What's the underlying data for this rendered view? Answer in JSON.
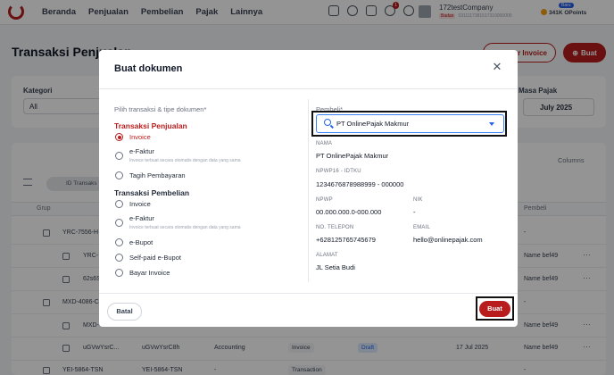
{
  "nav": {
    "items": [
      "Beranda",
      "Penjualan",
      "Pembelian",
      "Pajak",
      "Lainnya"
    ],
    "notification_count": "1",
    "company_name": "172testCompany",
    "company_tag": "Badan",
    "company_id": "0311117381517310000000",
    "points": "341K OPoints",
    "points_badge": "Baru"
  },
  "page": {
    "title": "Transaksi Penjualan",
    "btn_outline_label": "r Invoice",
    "btn_buat_label": "Buat",
    "filter_kategori_label": "Kategori",
    "filter_kategori_value": "All",
    "filter_masa_label": "Masa Pajak",
    "filter_masa_value": "July 2025",
    "columns_label": "Columns",
    "id_pill": "ID Transaks",
    "th_grup": "Grup",
    "th_pembeli": "Pembeli"
  },
  "rows": [
    {
      "id": "YRC-7556-H",
      "sub": "",
      "pembeli": "-"
    },
    {
      "id": "YRC-",
      "pembeli": "Name bef49"
    },
    {
      "id": "62s6S",
      "pembeli": "Name bef49"
    },
    {
      "id": "MXD-4086-C",
      "pembeli": "-"
    },
    {
      "id": "MXD-",
      "pembeli": "Name bef49"
    },
    {
      "id": "uGVwYsrC...",
      "ref": "uGVwYsrC8h",
      "category": "Accounting",
      "type": "Invoice",
      "status": "Draft",
      "date": "17 Jul 2025",
      "pembeli": "Name bef49"
    },
    {
      "id": "YEI-5864-TSN",
      "ref": "YEI-5864-TSN",
      "category": "-",
      "type": "Transaction",
      "pembeli": "-"
    }
  ],
  "modal": {
    "title": "Buat dokumen",
    "pilih_label": "Pilih transaksi & tipe dokumen*",
    "penjualan_head": "Transaksi Penjualan",
    "penjualan_opts": [
      {
        "label": "Invoice",
        "hint": "",
        "selected": true
      },
      {
        "label": "e-Faktur",
        "hint": "Invoice terbuat secara otomatis dengan data yang sama",
        "selected": false
      },
      {
        "label": "Tagih Pembayaran",
        "hint": "",
        "selected": false
      }
    ],
    "pembelian_head": "Transaksi Pembelian",
    "pembelian_opts": [
      {
        "label": "Invoice",
        "hint": ""
      },
      {
        "label": "e-Faktur",
        "hint": "Invoice terbuat secara otomatis dengan data yang sama"
      },
      {
        "label": "e-Bupot",
        "hint": ""
      },
      {
        "label": "Self-paid e-Bupot",
        "hint": ""
      },
      {
        "label": "Bayar Invoice",
        "hint": ""
      }
    ],
    "pembeli_label": "Pembeli*",
    "pembeli_value": "PT OnlinePajak Makmur",
    "details": {
      "nama_label": "NAMA",
      "nama": "PT OnlinePajak Makmur",
      "npwp16_label": "NPWP16 - IDTKU",
      "npwp16": "1234676878988999 - 000000",
      "npwp_label": "NPWP",
      "npwp": "00.000.000.0-000.000",
      "nik_label": "NIK",
      "nik": "-",
      "telp_label": "NO. TELEPON",
      "telp": "+628125765745679",
      "email_label": "EMAIL",
      "email": "hello@onlinepajak.com",
      "alamat_label": "ALAMAT",
      "alamat": "JL Setia Budi"
    },
    "batal_label": "Batal",
    "buat_label": "Buat"
  },
  "colors": {
    "brand": "#b91c1c",
    "focus_border": "#3b82f6"
  }
}
